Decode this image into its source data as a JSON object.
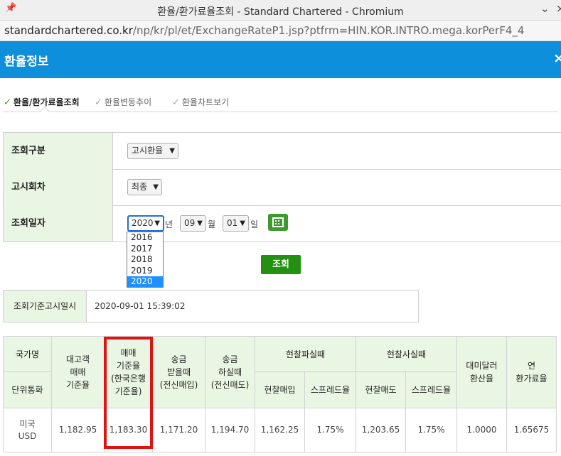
{
  "window": {
    "title": "환율/환가료율조회 - Standard Chartered - Chromium",
    "url_host": "standardchartered.co.kr",
    "url_path": "/np/kr/pl/et/ExchangeRateP1.jsp?ptfrm=HIN.KOR.INTRO.mega.korPerF4_4"
  },
  "header": {
    "title": "환율정보",
    "close_glyph": "×"
  },
  "tabs": [
    {
      "label": "환율/환가료율조회",
      "active": true
    },
    {
      "label": "환율변동추이",
      "active": false
    },
    {
      "label": "환율차트보기",
      "active": false
    }
  ],
  "form": {
    "row1_label": "조회구분",
    "row1_value": "고시환율",
    "row2_label": "고시회차",
    "row2_value": "최종",
    "row3_label": "조회일자",
    "year_value": "2020",
    "year_unit": "년",
    "month_value": "09",
    "month_unit": "월",
    "day_value": "01",
    "day_unit": "일",
    "year_options": [
      "2016",
      "2017",
      "2018",
      "2019",
      "2020"
    ],
    "year_highlight": "2020"
  },
  "query_button": "조회",
  "timestamp": {
    "label": "조회기준고시일시",
    "value": "2020-09-01 15:39:02"
  },
  "table": {
    "h_country": "국가명",
    "h_unit": "단위통화",
    "h_customer": [
      "대고객",
      "매매",
      "기준율"
    ],
    "h_base": [
      "매매",
      "기준율",
      "(한국은행",
      "기준율)"
    ],
    "h_remit_recv": [
      "송금",
      "받을때",
      "(전신매입)"
    ],
    "h_remit_send": [
      "송금",
      "하실때",
      "(전신매도)"
    ],
    "h_cash_sell": "현찰파실때",
    "h_cash_buy": "현찰사실때",
    "h_cash_buy_rate": "현찰매입",
    "h_spread1": "스프레드율",
    "h_cash_sell_rate": "현찰매도",
    "h_spread2": "스프레드율",
    "h_usd_conv": [
      "대미달러",
      "환산율"
    ],
    "h_annual": [
      "연",
      "환가료율"
    ],
    "row": {
      "country": "미국",
      "currency": "USD",
      "customer_rate": "1,182.95",
      "base_rate": "1,183.30",
      "remit_recv": "1,171.20",
      "remit_send": "1,194.70",
      "cash_buy": "1,162.25",
      "spread1": "1.75%",
      "cash_sell": "1,203.65",
      "spread2": "1.75%",
      "usd_conv": "1.0000",
      "annual": "1.65675"
    }
  }
}
